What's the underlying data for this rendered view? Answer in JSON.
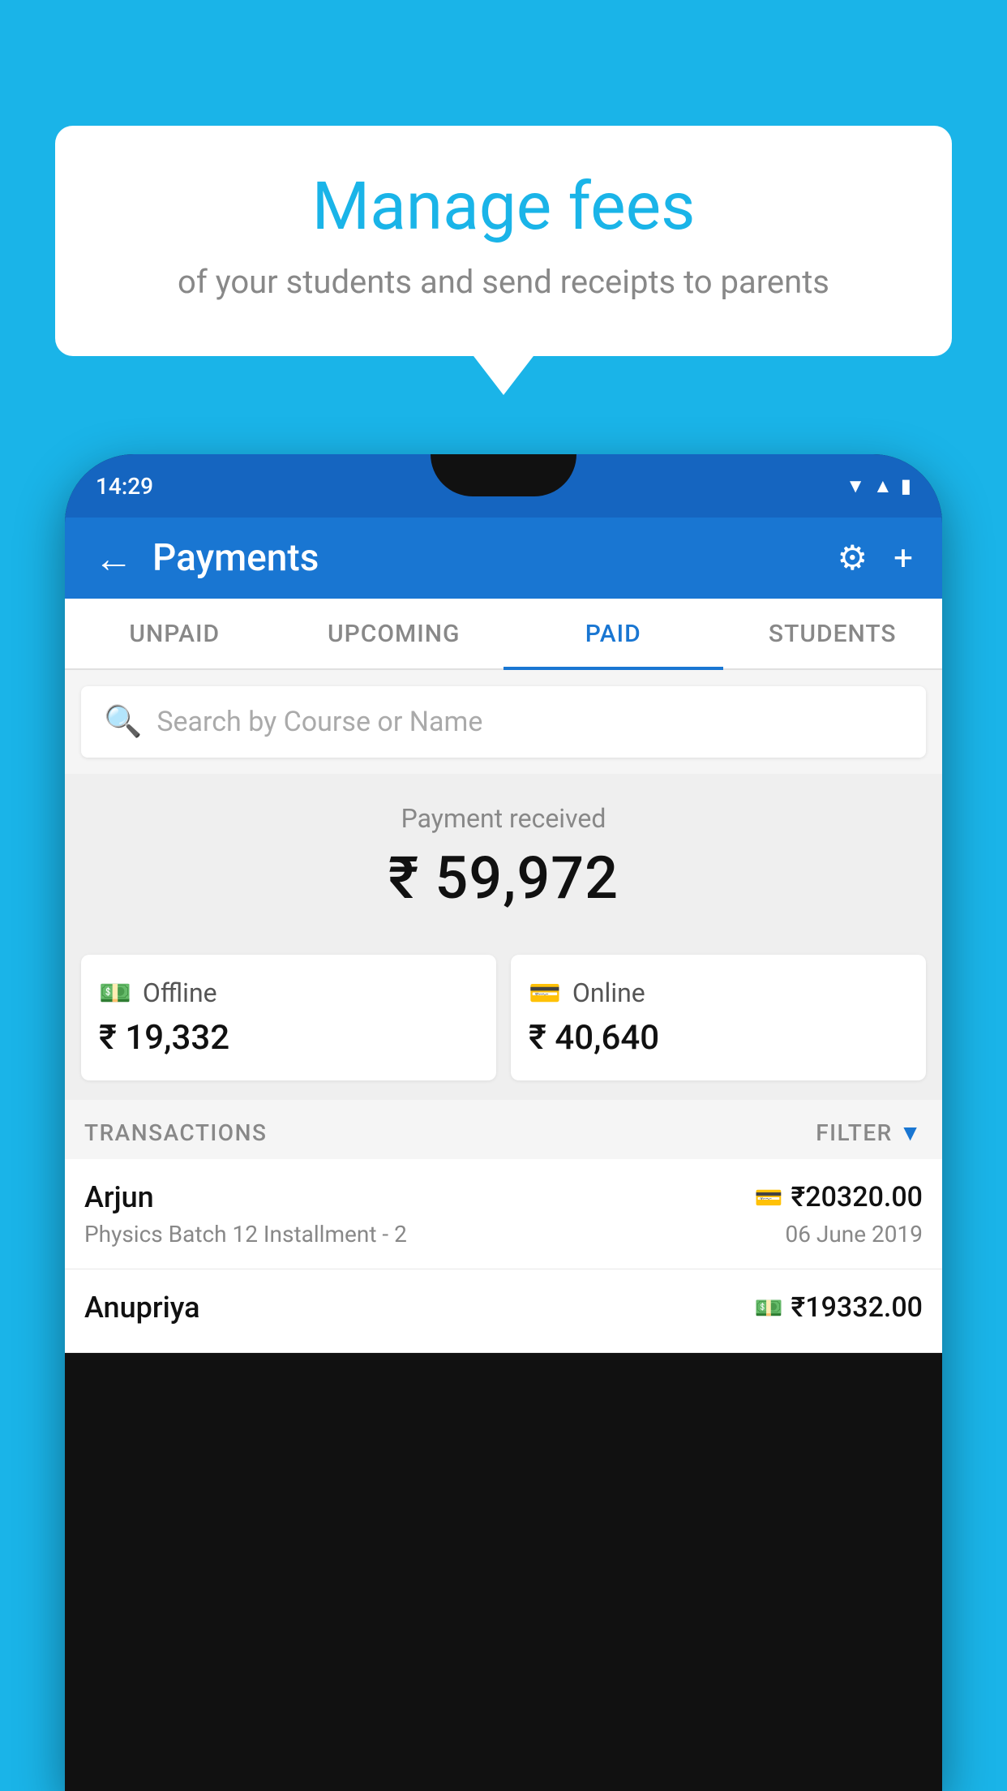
{
  "background_color": "#1ab4e8",
  "speech_bubble": {
    "title": "Manage fees",
    "subtitle": "of your students and send receipts to parents"
  },
  "phone": {
    "status_bar": {
      "time": "14:29"
    },
    "app_header": {
      "title": "Payments",
      "back_label": "←"
    },
    "tabs": [
      {
        "id": "unpaid",
        "label": "UNPAID",
        "active": false
      },
      {
        "id": "upcoming",
        "label": "UPCOMING",
        "active": false
      },
      {
        "id": "paid",
        "label": "PAID",
        "active": true
      },
      {
        "id": "students",
        "label": "STUDENTS",
        "active": false
      }
    ],
    "search": {
      "placeholder": "Search by Course or Name"
    },
    "payment_summary": {
      "label": "Payment received",
      "amount": "₹ 59,972",
      "offline": {
        "type": "Offline",
        "amount": "₹ 19,332"
      },
      "online": {
        "type": "Online",
        "amount": "₹ 40,640"
      }
    },
    "transactions": {
      "header_label": "TRANSACTIONS",
      "filter_label": "FILTER",
      "rows": [
        {
          "name": "Arjun",
          "course": "Physics Batch 12 Installment - 2",
          "amount": "₹20320.00",
          "date": "06 June 2019",
          "payment_type": "online"
        },
        {
          "name": "Anupriya",
          "course": "",
          "amount": "₹19332.00",
          "date": "",
          "payment_type": "offline"
        }
      ]
    }
  }
}
